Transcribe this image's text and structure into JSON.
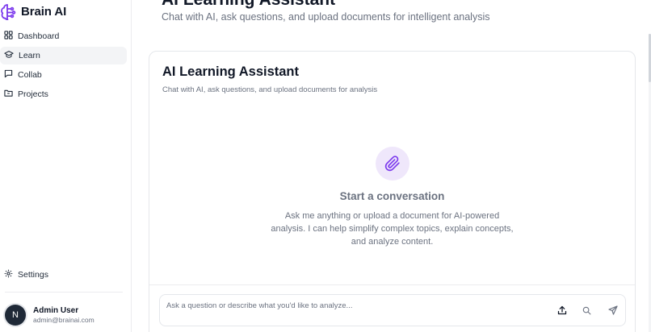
{
  "brand": {
    "name": "Brain AI",
    "icon": "brain-icon",
    "accent": "#7c3aed"
  },
  "sidebar": {
    "items": [
      {
        "label": "Dashboard",
        "icon": "grid-icon",
        "active": false
      },
      {
        "label": "Learn",
        "icon": "graduation-cap-icon",
        "active": true
      },
      {
        "label": "Collab",
        "icon": "message-square-icon",
        "active": false
      },
      {
        "label": "Projects",
        "icon": "folder-icon",
        "active": false
      }
    ],
    "settings": {
      "label": "Settings",
      "icon": "gear-icon"
    },
    "user": {
      "initial": "N",
      "name": "Admin User",
      "email": "admin@brainai.com"
    }
  },
  "page": {
    "title": "AI Learning Assistant",
    "subtitle": "Chat with AI, ask questions, and upload documents for intelligent analysis"
  },
  "card": {
    "title": "AI Learning Assistant",
    "subtitle": "Chat with AI, ask questions, and upload documents for analysis",
    "empty": {
      "icon": "paperclip-icon",
      "title": "Start a conversation",
      "text": "Ask me anything or upload a document for AI-powered analysis. I can help simplify complex topics, explain concepts, and analyze content."
    },
    "input": {
      "value": "",
      "placeholder": "Ask a question or describe what you'd like to analyze...",
      "tools": [
        "upload-icon",
        "search-icon",
        "send-icon"
      ]
    }
  }
}
